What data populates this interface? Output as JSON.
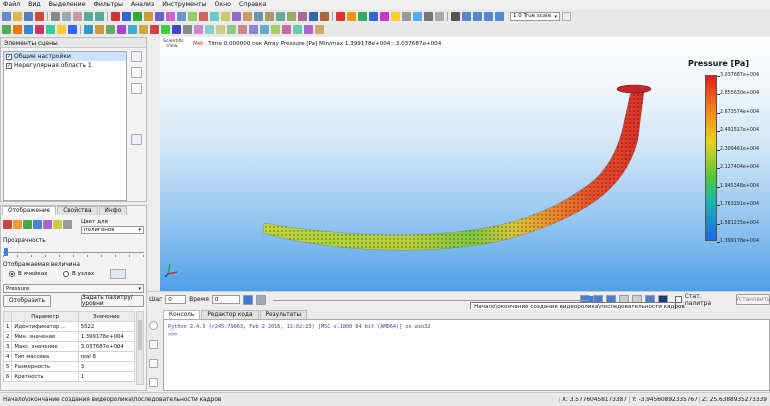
{
  "menu": [
    "Файл",
    "Вид",
    "Выделение",
    "Фильтры",
    "Анализ",
    "Инструменты",
    "Окно",
    "Справка"
  ],
  "toolbar": {
    "scale_value": "1.0 True scale"
  },
  "left_panel": {
    "title": "Элементы сцены",
    "tree": [
      {
        "label": "Общие настройки",
        "checked": true,
        "selected": true
      },
      {
        "label": "Нерегулярная область 1",
        "checked": true,
        "selected": false
      }
    ]
  },
  "display_panel": {
    "tabs": [
      "Отображение",
      "Свойства",
      "Инфо"
    ],
    "color_label": "Цвет для",
    "color_value": "полигонов",
    "transparency_label": "Прозрачность",
    "display_value_label": "Отображаемая величина",
    "radio_cells": "В ячейках",
    "radio_nodes": "В узлах",
    "array_value": "Pressure",
    "btn_display": "Отобразить",
    "btn_palette": "Задать палитру/уровни",
    "table": {
      "headers": [
        "Параметр",
        "Значение"
      ],
      "rows": [
        [
          "1",
          "Идентификатор ...",
          "5522"
        ],
        [
          "2",
          "Мин. значение",
          "1.399178e+004"
        ],
        [
          "3",
          "Макс. значение",
          "3.037687e+004"
        ],
        [
          "4",
          "Тип массива",
          "real 8"
        ],
        [
          "5",
          "Размерность",
          "3"
        ],
        [
          "6",
          "Кратность",
          "1"
        ]
      ]
    }
  },
  "viewport": {
    "orientation_label_1": "Scientific",
    "orientation_label_2": "View",
    "info_met": "Met",
    "info_time": "Time 0.000000 сек Array Pressure [Pa] Min/max 1.399178e+004 : 3.037687e+004",
    "legend": {
      "title": "Pressure [Pa]",
      "ticks": [
        "3.037687e+004",
        "2.855630e+004",
        "2.673574e+004",
        "2.491517e+004",
        "2.309461e+004",
        "2.127404e+004",
        "1.945348e+004",
        "1.763291e+004",
        "1.581235e+004",
        "1.399178e+004"
      ]
    }
  },
  "timeline": {
    "step_label": "Шаг",
    "step_value": "0",
    "time_label": "Время",
    "time_value": "0",
    "palette_label": "Стат. палитра",
    "apply_label": "Установить",
    "tooltip": "Начало\\окончание создания видеоролика\\последовательности кадров"
  },
  "bottom_tabs": [
    "Консоль",
    "Редактор кода",
    "Результаты"
  ],
  "console": {
    "line1": "Python 2.4.5 (r245:79063, Feb  2 2016, 11:02:23) [MSC v.1800 64 bit (AMD64)] on win32",
    "line2": ">>>"
  },
  "status": {
    "message": "Начало\\окончание создания видеоролика\\последовательности кадров",
    "x": "X: 3.57760458173387",
    "y": "Y: -3.94560892335767",
    "z": "Z: 25.6388935273339"
  }
}
